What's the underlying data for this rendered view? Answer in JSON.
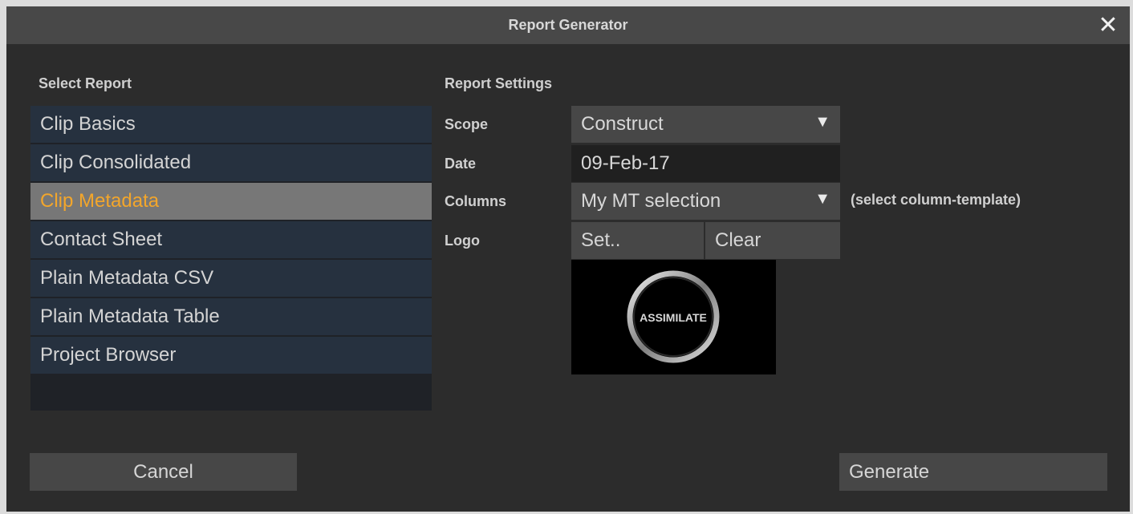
{
  "window": {
    "title": "Report Generator",
    "close_label": "✕"
  },
  "left": {
    "heading": "Select Report",
    "reports": [
      "Clip Basics",
      "Clip Consolidated",
      "Clip Metadata",
      "Contact Sheet",
      "Plain Metadata CSV",
      "Plain Metadata Table",
      "Project Browser"
    ],
    "selected_report": "Clip Metadata"
  },
  "settings": {
    "heading": "Report Settings",
    "scope_label": "Scope",
    "scope_value": "Construct",
    "date_label": "Date",
    "date_value": "09-Feb-17",
    "columns_label": "Columns",
    "columns_value": "My MT selection",
    "columns_hint": "(select column-template)",
    "logo_label": "Logo",
    "logo_set": "Set..",
    "logo_clear": "Clear",
    "logo_text": "ASSIMILATE",
    "dropdown_arrow": "▼"
  },
  "buttons": {
    "cancel": "Cancel",
    "generate": "Generate"
  },
  "colors": {
    "selected_text": "#f3a62b",
    "list_item": "#26313f",
    "background": "#2c2c2c"
  }
}
